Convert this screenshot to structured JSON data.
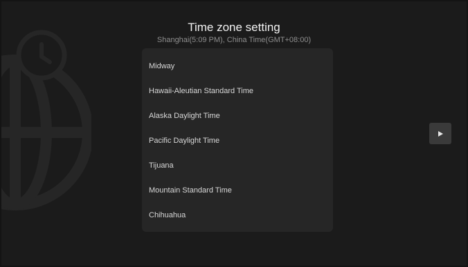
{
  "header": {
    "title": "Time zone setting",
    "subtitle": "Shanghai(5:09 PM), China Time(GMT+08:00)"
  },
  "timezones": [
    "Midway",
    "Hawaii-Aleutian Standard Time",
    "Alaska Daylight Time",
    "Pacific Daylight Time",
    "Tijuana",
    "Mountain Standard Time",
    "Chihuahua"
  ],
  "icons": {
    "background": "globe-clock-icon",
    "next": "play-arrow-icon"
  },
  "colors": {
    "background": "#1b1b1b",
    "list_background": "#262626",
    "button_background": "#3a3a3a"
  }
}
